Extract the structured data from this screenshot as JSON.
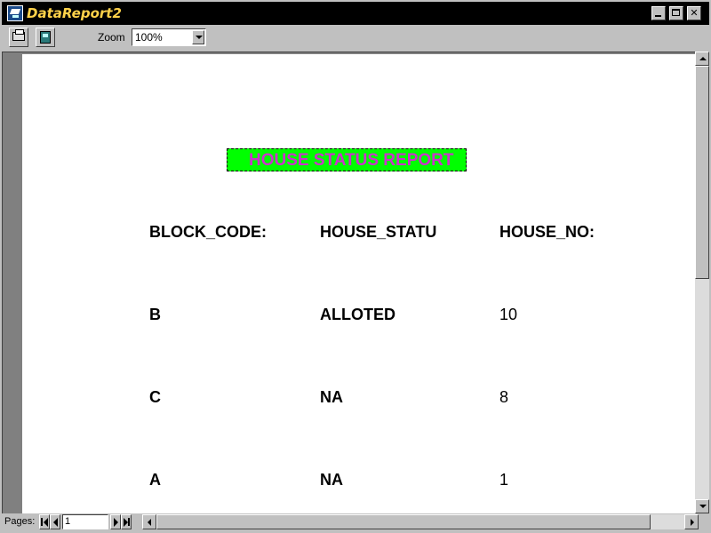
{
  "window": {
    "title": "DataReport2",
    "title_color": "#ffd24a",
    "buttons": {
      "minimize": "minimize",
      "maximize": "maximize",
      "close": "close"
    }
  },
  "toolbar": {
    "print_icon": "printer-icon",
    "export_icon": "export-icon",
    "zoom_label": "Zoom",
    "zoom_value": "100%"
  },
  "report": {
    "title": "HOUSE STATUS REPORT",
    "title_bg_color": "#00ff00",
    "title_text_color": "#cc33cc",
    "headers": [
      "BLOCK_CODE:",
      "HOUSE_STATU",
      "HOUSE_NO:"
    ],
    "rows": [
      [
        "B",
        "ALLOTED",
        "10"
      ],
      [
        "C",
        "NA",
        "8"
      ],
      [
        "A",
        "NA",
        "1"
      ]
    ]
  },
  "footer": {
    "pages_label": "Pages:",
    "current_page": "1"
  }
}
